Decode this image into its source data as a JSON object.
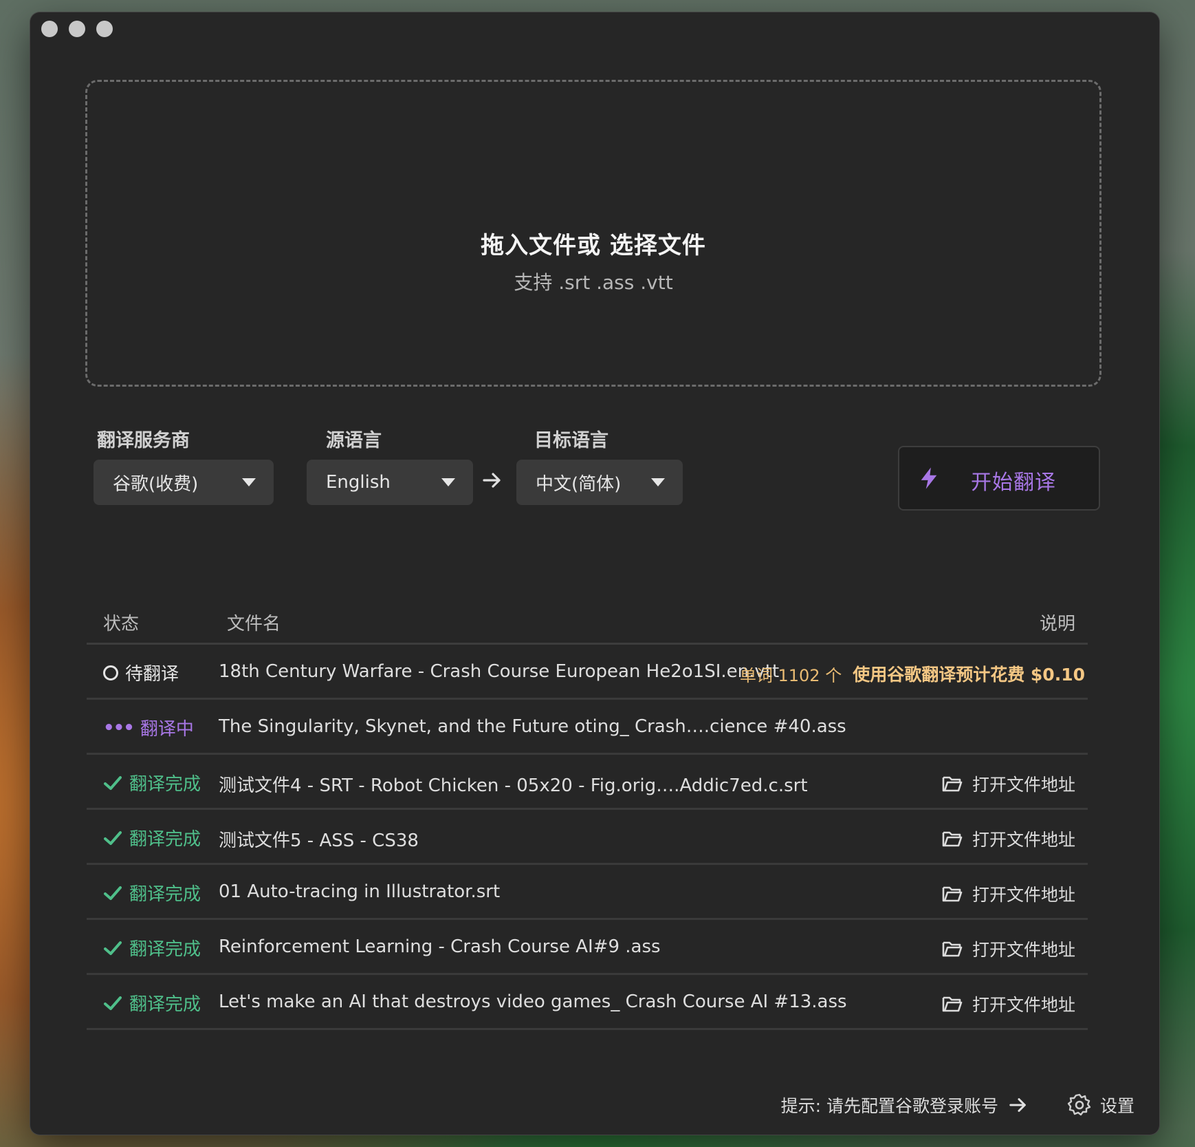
{
  "dropzone": {
    "title": "拖入文件或 选择文件",
    "subtitle": "支持 .srt .ass .vtt"
  },
  "controls": {
    "provider_label": "翻译服务商",
    "provider_value": "谷歌(收费)",
    "source_label": "源语言",
    "source_value": "English",
    "target_label": "目标语言",
    "target_value": "中文(简体)",
    "start_button": "开始翻译"
  },
  "table": {
    "headers": {
      "status": "状态",
      "filename": "文件名",
      "note": "说明"
    },
    "rows": [
      {
        "status": "待翻译",
        "status_kind": "pending",
        "filename": "18th Century Warfare - Crash Course European He2o1SI.en.vtt",
        "note_words": "单词 1102 个",
        "note_cost": "使用谷歌翻译预计花费 $0.10",
        "action": ""
      },
      {
        "status": "翻译中",
        "status_kind": "working",
        "filename": "The Singularity, Skynet, and the Future oting_ Crash….cience #40.ass",
        "note_words": "",
        "note_cost": "",
        "action": ""
      },
      {
        "status": "翻译完成",
        "status_kind": "done",
        "filename": "测试文件4 - SRT - Robot Chicken - 05x20 - Fig.orig….Addic7ed.c.srt",
        "note_words": "",
        "note_cost": "",
        "action": "打开文件地址"
      },
      {
        "status": "翻译完成",
        "status_kind": "done",
        "filename": "测试文件5 - ASS - CS38",
        "note_words": "",
        "note_cost": "",
        "action": "打开文件地址"
      },
      {
        "status": "翻译完成",
        "status_kind": "done",
        "filename": "01 Auto-tracing in Illustrator.srt",
        "note_words": "",
        "note_cost": "",
        "action": "打开文件地址"
      },
      {
        "status": "翻译完成",
        "status_kind": "done",
        "filename": "Reinforcement Learning -  Crash Course AI#9 .ass",
        "note_words": "",
        "note_cost": "",
        "action": "打开文件地址"
      },
      {
        "status": "翻译完成",
        "status_kind": "done",
        "filename": "Let's make an AI that destroys video games_ Crash Course AI #13.ass",
        "note_words": "",
        "note_cost": "",
        "action": "打开文件地址"
      }
    ]
  },
  "footer": {
    "hint": "提示: 请先配置谷歌登录账号",
    "settings": "设置"
  },
  "icons": {
    "start": "lightning-icon",
    "pending": "circle-icon",
    "working": "ellipsis-icon",
    "done": "checkmark-icon",
    "open": "folder-open-icon",
    "settings": "gear-icon",
    "hint_arrow": "arrow-right-icon"
  },
  "colors": {
    "accent_purple": "#a877e6",
    "done_green": "#4fbf8a",
    "cost_orange": "#e9bb73"
  }
}
